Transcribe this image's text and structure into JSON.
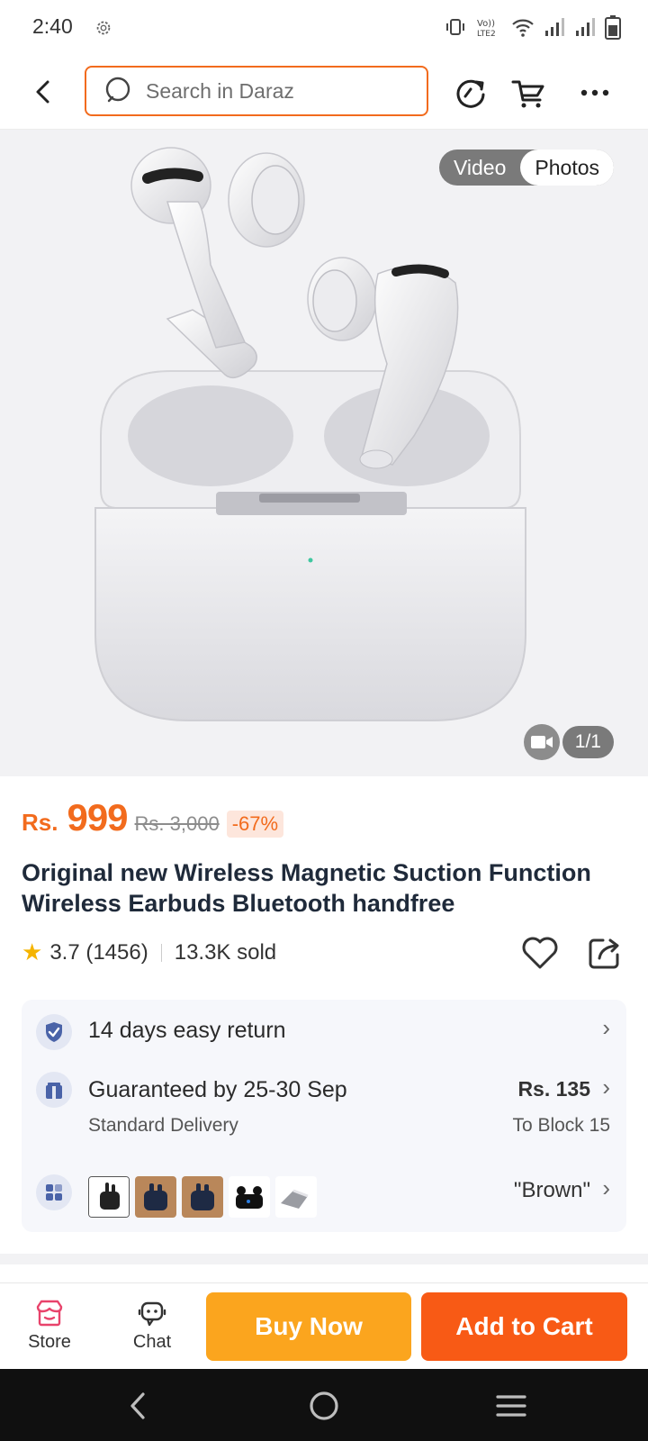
{
  "status_bar": {
    "time": "2:40",
    "icons": [
      "gear-icon",
      "vibrate-icon",
      "volte-icon",
      "wifi-icon",
      "signal-icon",
      "signal-icon",
      "battery-icon"
    ]
  },
  "header": {
    "search_placeholder": "Search in Daraz",
    "icons": [
      "back-icon",
      "search-icon",
      "refresh-icon",
      "cart-icon",
      "more-icon"
    ]
  },
  "gallery": {
    "media_tabs": [
      "Video",
      "Photos"
    ],
    "active_tab": "Photos",
    "counter": "1/1"
  },
  "product": {
    "currency": "Rs.",
    "price": "999",
    "original_price": "Rs. 3,000",
    "discount": "-67%",
    "title": "Original new Wireless Magnetic Suction Function Wireless Earbuds Bluetooth handfree",
    "rating": "3.7 (1456)",
    "sold": "13.3K sold"
  },
  "services": {
    "return": "14 days easy return",
    "delivery_title": "Guaranteed by 25-30 Sep",
    "delivery_sub": "Standard Delivery",
    "delivery_price": "Rs. 135",
    "delivery_to": "To Block 15",
    "variant": "\"Brown\""
  },
  "action_bar": {
    "store": "Store",
    "chat": "Chat",
    "buy_now": "Buy Now",
    "add_to_cart": "Add to Cart"
  },
  "colors": {
    "brand_orange": "#f26b1d",
    "buy_now": "#fba51e",
    "add_to_cart": "#f85a15",
    "star": "#f5b400"
  }
}
